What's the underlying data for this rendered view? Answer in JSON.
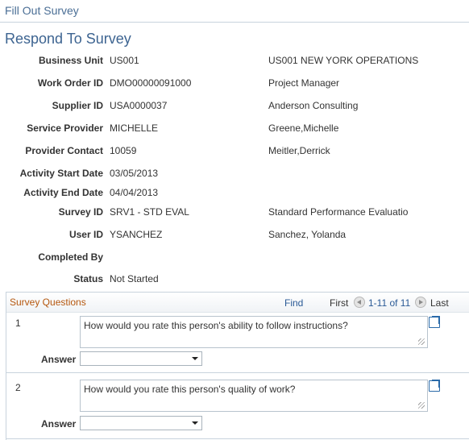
{
  "header": {
    "title": "Fill Out Survey"
  },
  "page": {
    "title": "Respond To Survey"
  },
  "fields": [
    {
      "label": "Business Unit",
      "value": "US001",
      "description": "US001 NEW YORK OPERATIONS"
    },
    {
      "label": "Work Order ID",
      "value": "DMO00000091000",
      "description": "Project Manager"
    },
    {
      "label": "Supplier ID",
      "value": "USA0000037",
      "description": "Anderson Consulting"
    },
    {
      "label": "Service Provider",
      "value": "MICHELLE",
      "description": "Greene,Michelle"
    },
    {
      "label": "Provider Contact",
      "value": "10059",
      "description": "Meitler,Derrick"
    },
    {
      "label": "Activity Start Date",
      "value": "03/05/2013",
      "description": ""
    },
    {
      "label": "Activity End Date",
      "value": "04/04/2013",
      "description": ""
    },
    {
      "label": "Survey ID",
      "value": "SRV1 - STD EVAL",
      "description": "Standard Performance Evaluatio"
    },
    {
      "label": "User ID",
      "value": "YSANCHEZ",
      "description": "Sanchez, Yolanda"
    },
    {
      "label": "Completed By",
      "value": "",
      "description": ""
    },
    {
      "label": "Status",
      "value": "Not Started",
      "description": ""
    }
  ],
  "grid": {
    "title": "Survey Questions",
    "find": "Find",
    "first": "First",
    "range": "1-11 of 11",
    "last": "Last",
    "answer_label": "Answer",
    "rows": [
      {
        "num": "1",
        "question": "How would you rate this person's ability to follow instructions?",
        "answer": ""
      },
      {
        "num": "2",
        "question": "How would you rate this person's quality of work?",
        "answer": ""
      }
    ]
  }
}
